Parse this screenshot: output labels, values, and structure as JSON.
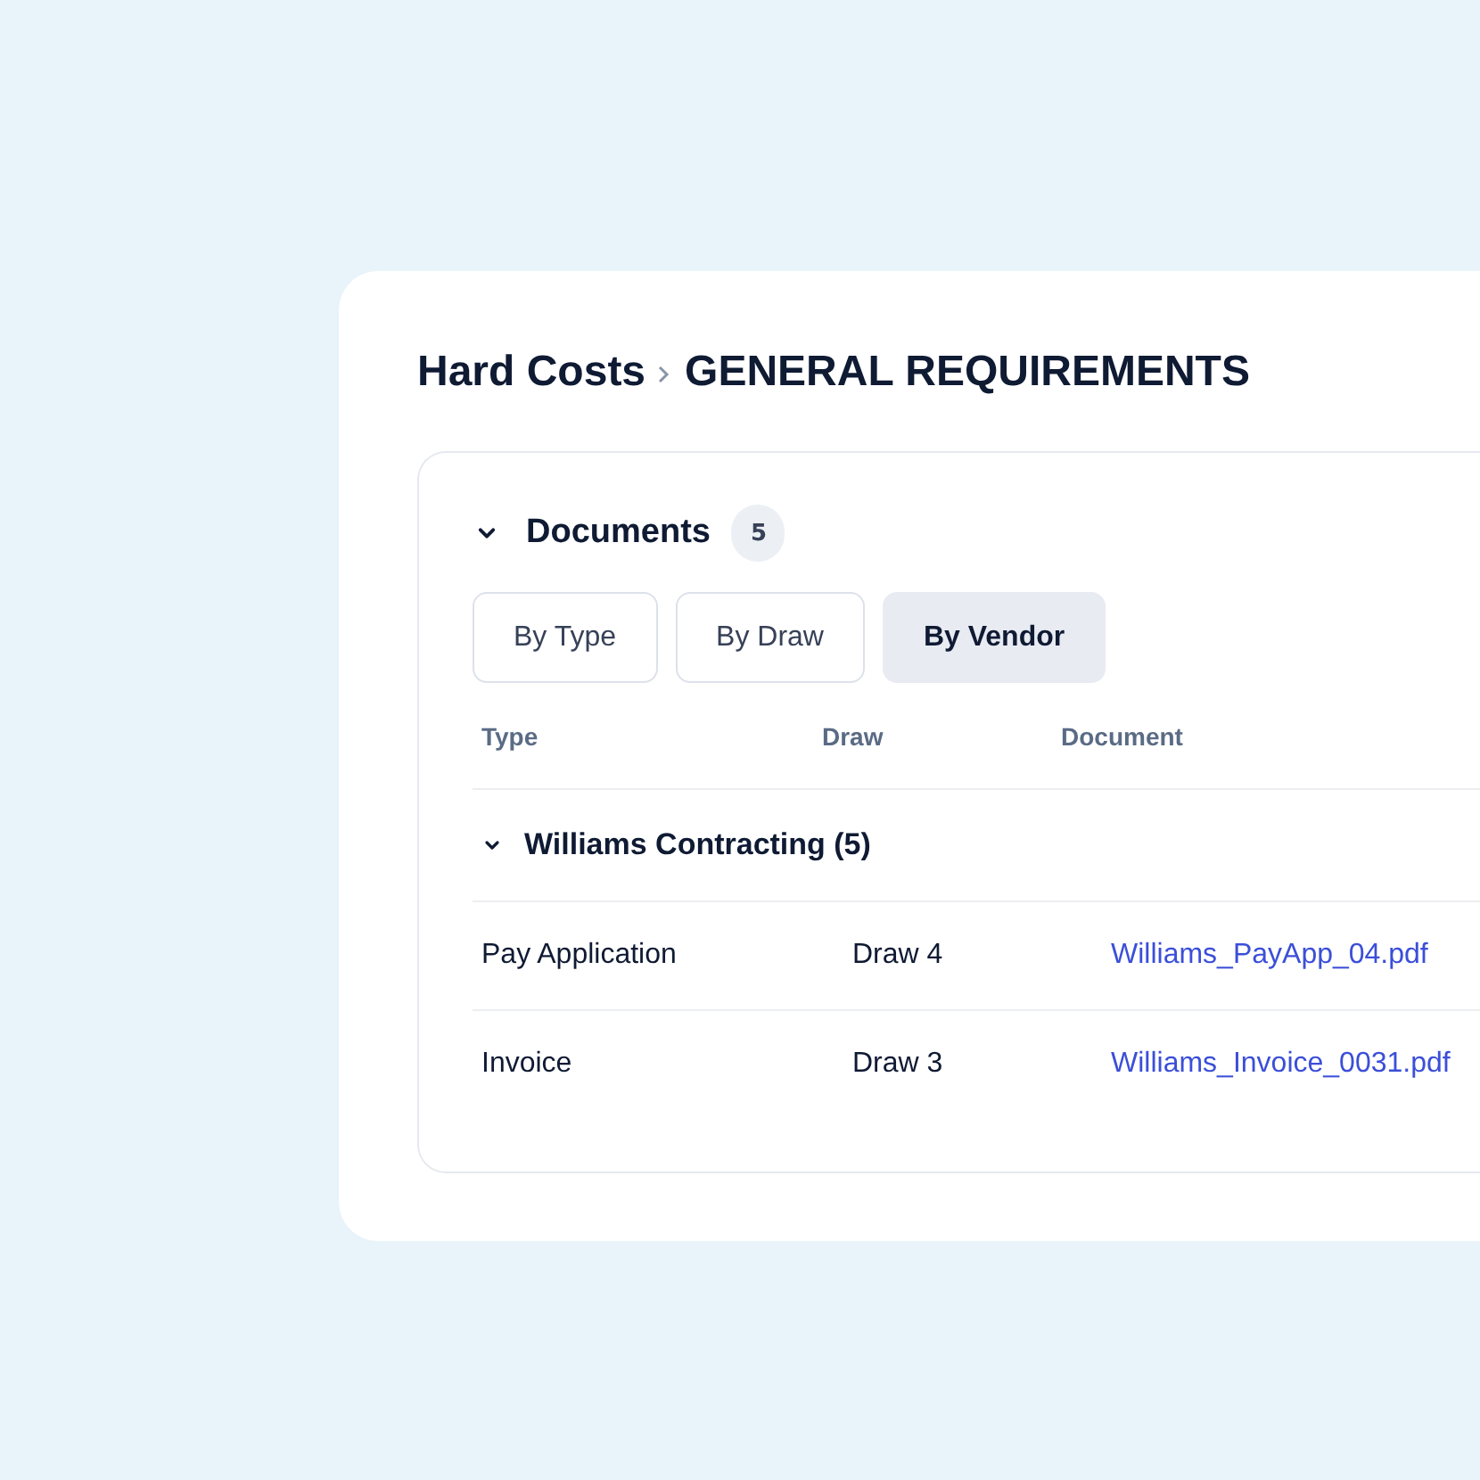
{
  "breadcrumb": {
    "parent": "Hard Costs",
    "current": "GENERAL REQUIREMENTS"
  },
  "documents": {
    "title": "Documents",
    "count": "5",
    "expanded": true,
    "tabs": [
      {
        "label": "By Type",
        "selected": false
      },
      {
        "label": "By Draw",
        "selected": false
      },
      {
        "label": "By Vendor",
        "selected": true
      }
    ],
    "table": {
      "columns": [
        "Type",
        "Draw",
        "Document"
      ],
      "groups": [
        {
          "label": "Williams Contracting (5)",
          "expanded": true,
          "rows": [
            {
              "type": "Pay Application",
              "draw": "Draw 4",
              "document": "Williams_PayApp_04.pdf"
            },
            {
              "type": "Invoice",
              "draw": "Draw 3",
              "document": "Williams_Invoice_0031.pdf"
            }
          ]
        }
      ]
    }
  }
}
